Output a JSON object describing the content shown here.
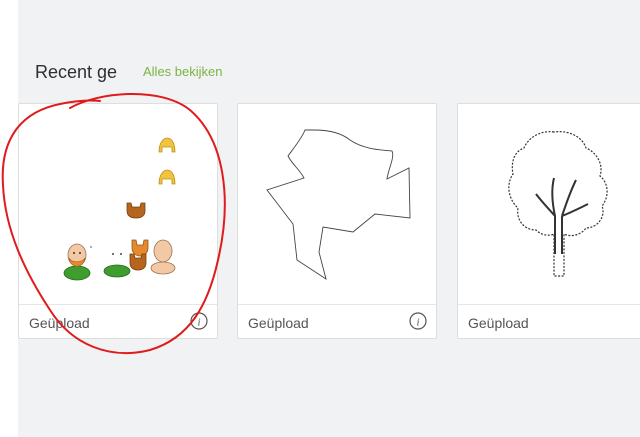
{
  "section": {
    "title": "Recent ge",
    "see_all": "Alles bekijken"
  },
  "cards": [
    {
      "label": "Geüpload",
      "thumbnail": "avatar-parts-sheet-icon",
      "info_icon": "info-icon"
    },
    {
      "label": "Geüpload",
      "thumbnail": "bird-outline-icon",
      "info_icon": "info-icon"
    },
    {
      "label": "Geüpload",
      "thumbnail": "tree-outline-icon",
      "info_icon": "info-icon"
    }
  ],
  "colors": {
    "accent_link": "#7cb342",
    "annotation": "#e01b1b",
    "panel_bg": "#f1f2f4"
  }
}
